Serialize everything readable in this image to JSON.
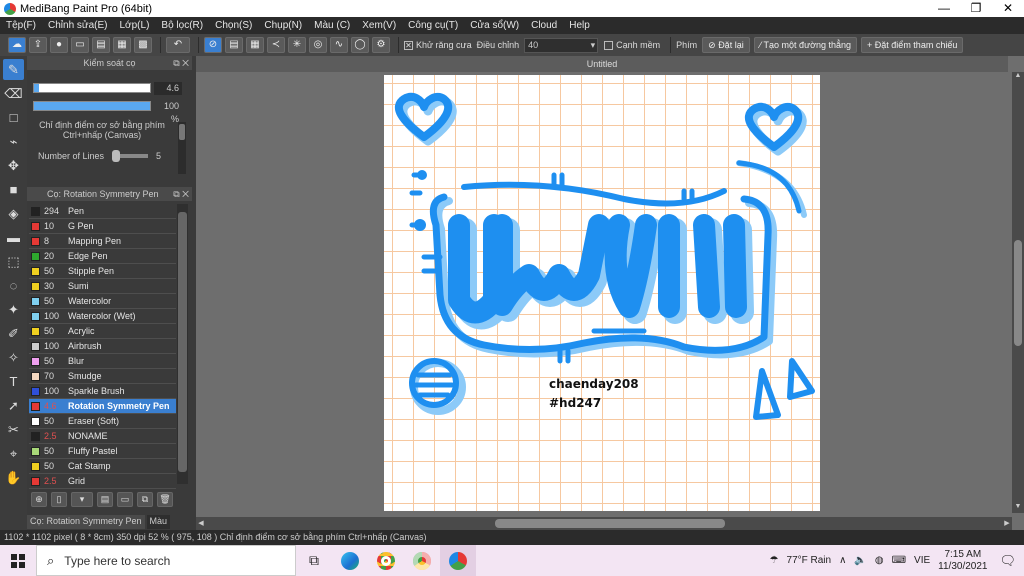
{
  "window": {
    "title": "MediBang Paint Pro (64bit)"
  },
  "menu": [
    "Tệp(F)",
    "Chỉnh sửa(E)",
    "Lớp(L)",
    "Bộ lọc(R)",
    "Chọn(S)",
    "Chụp(N)",
    "Màu (C)",
    "Xem(V)",
    "Công cụ(T)",
    "Cửa sổ(W)",
    "Cloud",
    "Help"
  ],
  "toolbar": {
    "antialias_label": "Khử răng cưa",
    "adjust_label": "Điều chỉnh",
    "adjust_value": "40",
    "smooth_label": "Cạnh mềm",
    "key_label": "Phím",
    "reset_label": "Đặt lại",
    "line_label": "Tạo một đường thẳng",
    "refpoint_label": "Đặt điểm tham chiếu"
  },
  "brush_control": {
    "title": "Kiểm soát cọ",
    "size_value": "4.6",
    "size_fraction": 0.04,
    "opacity_value": "100 %",
    "opacity_fraction": 1.0,
    "hint": "Chỉ định điểm cơ sở bằng phím Ctrl+nhấp (Canvas)",
    "lines_label": "Number of Lines",
    "lines_value": "5"
  },
  "brush_list": {
    "title": "Cọ: Rotation Symmetry Pen",
    "items": [
      {
        "size": "294",
        "name": "Pen",
        "color": "#222222"
      },
      {
        "size": "10",
        "name": "G Pen",
        "color": "#e53935"
      },
      {
        "size": "8",
        "name": "Mapping Pen",
        "color": "#e53935"
      },
      {
        "size": "20",
        "name": "Edge Pen",
        "color": "#2ea82e"
      },
      {
        "size": "50",
        "name": "Stipple Pen",
        "color": "#f0d020"
      },
      {
        "size": "30",
        "name": "Sumi",
        "color": "#f0d020"
      },
      {
        "size": "50",
        "name": "Watercolor",
        "color": "#7fd0f0"
      },
      {
        "size": "100",
        "name": "Watercolor (Wet)",
        "color": "#7fd0f0"
      },
      {
        "size": "50",
        "name": "Acrylic",
        "color": "#f0d020"
      },
      {
        "size": "100",
        "name": "Airbrush",
        "color": "#cccccc"
      },
      {
        "size": "50",
        "name": "Blur",
        "color": "#f0a0f0"
      },
      {
        "size": "70",
        "name": "Smudge",
        "color": "#f4d8c0"
      },
      {
        "size": "100",
        "name": "Sparkle Brush",
        "color": "#2f4fd8"
      },
      {
        "size": "4.6",
        "name": "Rotation Symmetry Pen",
        "color": "#e53935",
        "selected": true,
        "red": true
      },
      {
        "size": "50",
        "name": "Eraser (Soft)",
        "color": "#ffffff"
      },
      {
        "size": "2.5",
        "name": "NONAME",
        "color": "#222222",
        "red": true
      },
      {
        "size": "50",
        "name": "Fluffy Pastel",
        "color": "#a8d878"
      },
      {
        "size": "50",
        "name": "Cat Stamp",
        "color": "#f0d020"
      },
      {
        "size": "2.5",
        "name": "Grid",
        "color": "#e53935",
        "red": true
      }
    ]
  },
  "bottom_tabs": [
    "Cọ: Rotation Symmetry Pen",
    "Màu"
  ],
  "canvas": {
    "doc_title": "Untitled",
    "text_line1": "chaenday208",
    "text_line2": "#hd247"
  },
  "status": "1102 * 1102 pixel  ( 8 * 8cm)  350 dpi  52 %  ( 975, 108 )  Chỉ định điểm cơ sở bằng phím Ctrl+nhấp (Canvas)",
  "taskbar": {
    "search_placeholder": "Type here to search",
    "weather": "77°F  Rain",
    "lang": "VIE",
    "time": "7:15 AM",
    "date": "11/30/2021"
  },
  "colors": {
    "accent": "#3a7fd0",
    "art_blue": "#1e8ff0",
    "art_light": "#8ccaf8"
  }
}
